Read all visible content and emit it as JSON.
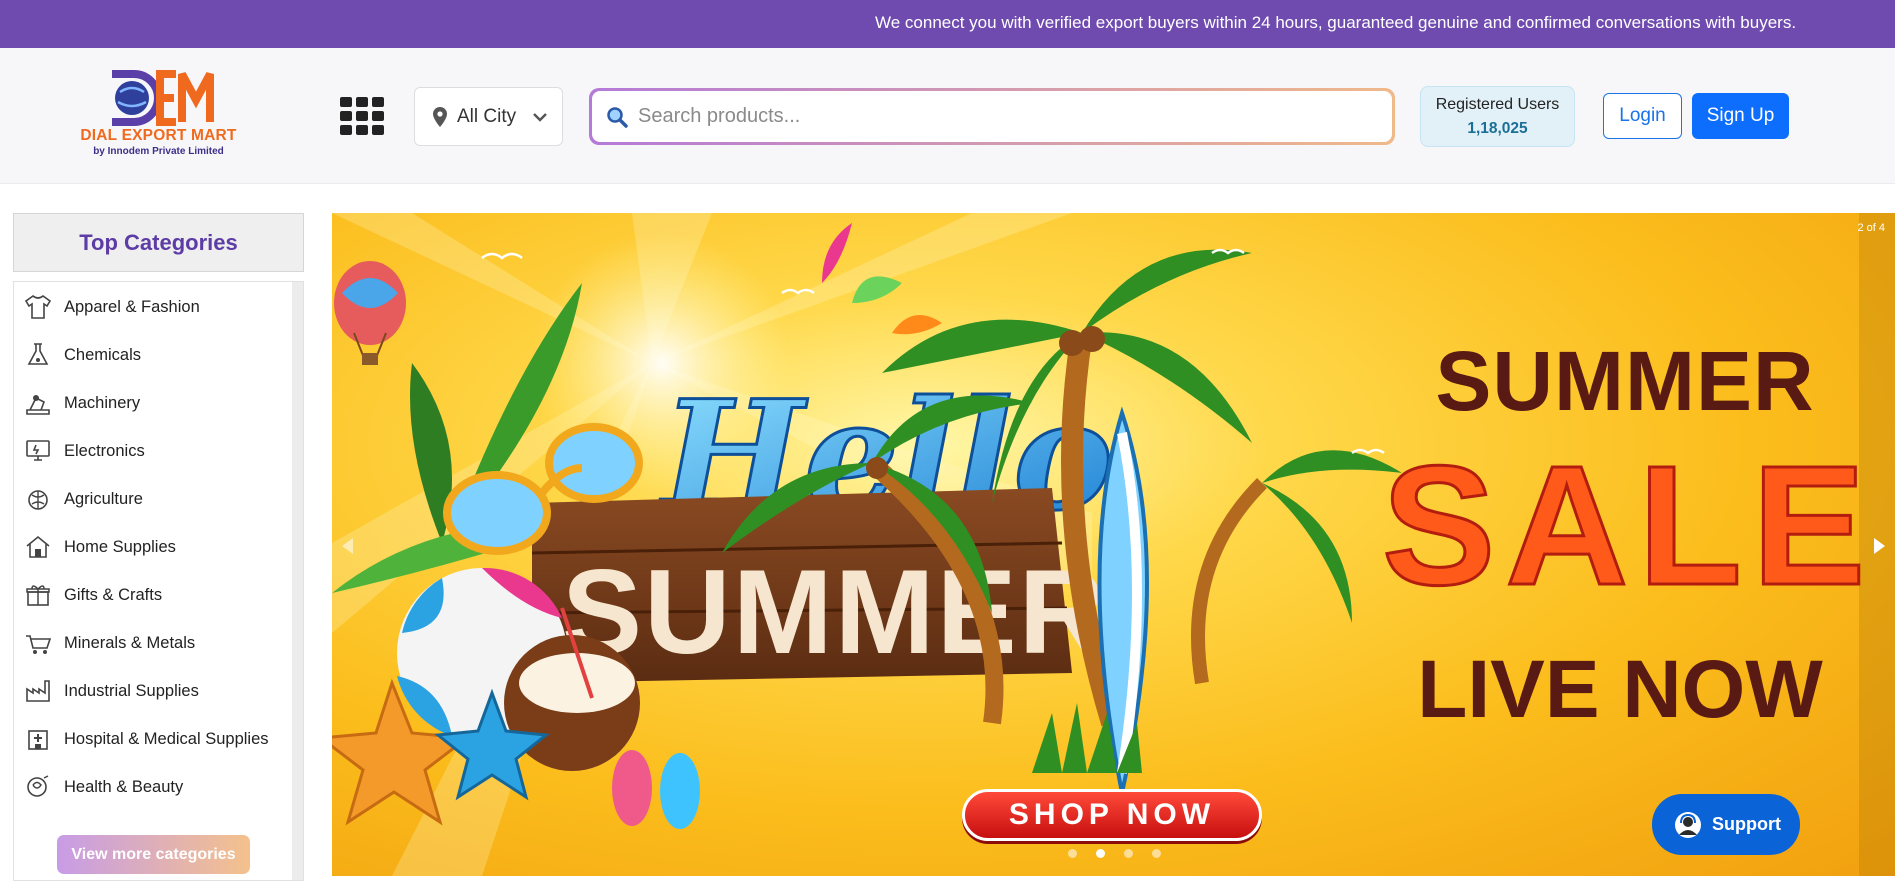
{
  "topbar": {
    "message": "We connect you with verified export buyers within 24 hours, guaranteed genuine and confirmed conversations with buyers."
  },
  "header": {
    "logo_mark": "DEM",
    "logo_title": "DIAL EXPORT MART",
    "logo_subtitle": "by Innodem Private Limited",
    "city_label": "All City",
    "search_placeholder": "Search products...",
    "registered_label": "Registered Users",
    "registered_count": "1,18,025",
    "login_label": "Login",
    "signup_label": "Sign Up"
  },
  "sidebar": {
    "title": "Top Categories",
    "items": [
      {
        "label": "Apparel & Fashion",
        "icon": "shirt-icon"
      },
      {
        "label": "Chemicals",
        "icon": "flask-icon"
      },
      {
        "label": "Machinery",
        "icon": "machinery-icon"
      },
      {
        "label": "Electronics",
        "icon": "electronics-icon"
      },
      {
        "label": "Agriculture",
        "icon": "agriculture-icon"
      },
      {
        "label": "Home Supplies",
        "icon": "home-icon"
      },
      {
        "label": "Gifts & Crafts",
        "icon": "gift-icon"
      },
      {
        "label": "Minerals & Metals",
        "icon": "cart-icon"
      },
      {
        "label": "Industrial Supplies",
        "icon": "factory-icon"
      },
      {
        "label": "Hospital & Medical Supplies",
        "icon": "hospital-icon"
      },
      {
        "label": "Health & Beauty",
        "icon": "beauty-icon"
      }
    ],
    "more_label": "View more categories"
  },
  "banner": {
    "slide_counter": "2 of 4",
    "hello": "Hello",
    "summer_sign": "SUMMER",
    "headline_1": "SUMMER",
    "headline_2": "SALE",
    "headline_3": "LIVE NOW",
    "cta": "SHOP NOW",
    "slide_total": 4,
    "active_slide": 2
  },
  "support": {
    "label": "Support"
  },
  "colors": {
    "topbar": "#6f4bb0",
    "primary": "#0d6efd",
    "brand_orange": "#ef6a1e",
    "brand_purple": "#5e3ca6"
  }
}
